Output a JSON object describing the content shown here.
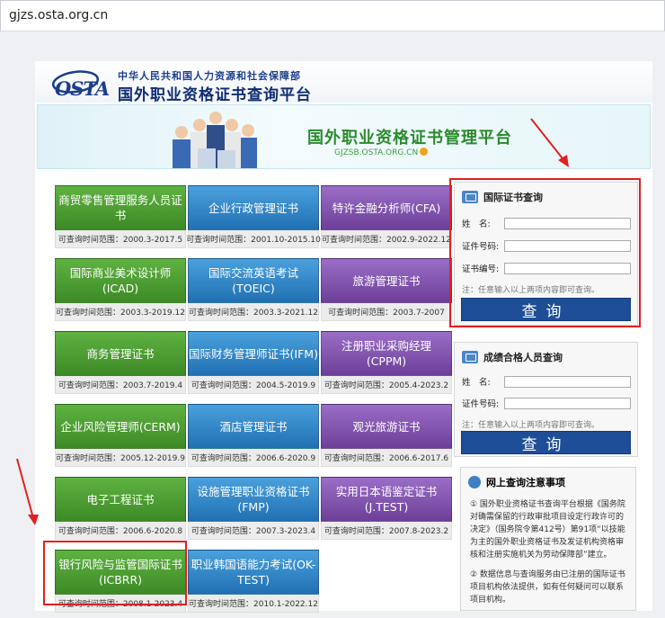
{
  "browser": {
    "url": "gjzs.osta.org.cn"
  },
  "header": {
    "logo_text": "OSTA",
    "ministry": "中华人民共和国人力资源和社会保障部",
    "platform_title": "国外职业资格证书查询平台"
  },
  "banner": {
    "title": "国外职业资格证书管理平台",
    "url": "GJZSB.OSTA.ORG.CN"
  },
  "tiles": [
    {
      "label": "商贸零售管理服务人员证书",
      "range": "可查询时间范围：2000.3-2017.5",
      "color": "green"
    },
    {
      "label": "企业行政管理证书",
      "range": "可查询时间范围：2001.10-2015.10",
      "color": "blue"
    },
    {
      "label": "特许金融分析师(CFA)",
      "range": "可查询时间范围：2002.9-2022.12",
      "color": "purple"
    },
    {
      "label": "国际商业美术设计师(ICAD)",
      "range": "可查询时间范围：2003.3-2019.12",
      "color": "green"
    },
    {
      "label": "国际交流英语考试(TOEIC)",
      "range": "可查询时间范围：2003.3-2021.12",
      "color": "blue"
    },
    {
      "label": "旅游管理证书",
      "range": "可查询时间范围：2003.7-2007",
      "color": "purple"
    },
    {
      "label": "商务管理证书",
      "range": "可查询时间范围：2003.7-2019.4",
      "color": "green"
    },
    {
      "label": "国际财务管理师证书(IFM)",
      "range": "可查询时间范围：2004.5-2019.9",
      "color": "blue"
    },
    {
      "label": "注册职业采购经理(CPPM)",
      "range": "可查询时间范围：2005.4-2023.2",
      "color": "purple"
    },
    {
      "label": "企业风险管理师(CERM)",
      "range": "可查询时间范围：2005.12-2019.9",
      "color": "green"
    },
    {
      "label": "酒店管理证书",
      "range": "可查询时间范围：2006.6-2020.9",
      "color": "blue"
    },
    {
      "label": "观光旅游证书",
      "range": "可查询时间范围：2006.6-2017.6",
      "color": "purple"
    },
    {
      "label": "电子工程证书",
      "range": "可查询时间范围：2006.6-2020.8",
      "color": "green"
    },
    {
      "label": "设施管理职业资格证书(FMP)",
      "range": "可查询时间范围：2007.3-2023.4",
      "color": "blue"
    },
    {
      "label": "实用日本语鉴定证书(J.TEST)",
      "range": "可查询时间范围：2007.8-2023.2",
      "color": "purple"
    },
    {
      "label": "银行风险与监管国际证书(ICBRR)",
      "range": "可查询时间范围：2008.1-2023.4",
      "color": "green"
    },
    {
      "label": "职业韩国语能力考试(OK-TEST)",
      "range": "可查询时间范围：2010.1-2022.12",
      "color": "blue"
    }
  ],
  "cert_query": {
    "title": "国际证书查询",
    "name_label": "姓　名:",
    "id_label": "证件号码:",
    "cert_label": "证书编号:",
    "note": "注：任意输入以上两项内容即可查询。",
    "button": "查询"
  },
  "score_query": {
    "title": "成绩合格人员查询",
    "name_label": "姓　名:",
    "id_label": "证件号码:",
    "note": "注：任意输入以上两项内容即可查询。",
    "button": "查询"
  },
  "notice": {
    "title": "网上查询注意事项",
    "p1": "① 国外职业资格证书查询平台根据《国务院对确需保留的行政审批项目设定行政许可的决定》（国务院令第412号）第91项“以技能为主的国外职业资格证书及发证机构资格审核和注册实施机关为劳动保障部”建立。",
    "p2": "② 数据信息与查询服务由已注册的国际证书项目机构依法提供，如有任何疑问可以联系项目机构。"
  },
  "colors": {
    "green": "#4a9a30",
    "blue": "#2d7fc2",
    "purple": "#7e52ad",
    "highlight": "#e02020",
    "button": "#1e4e97"
  }
}
